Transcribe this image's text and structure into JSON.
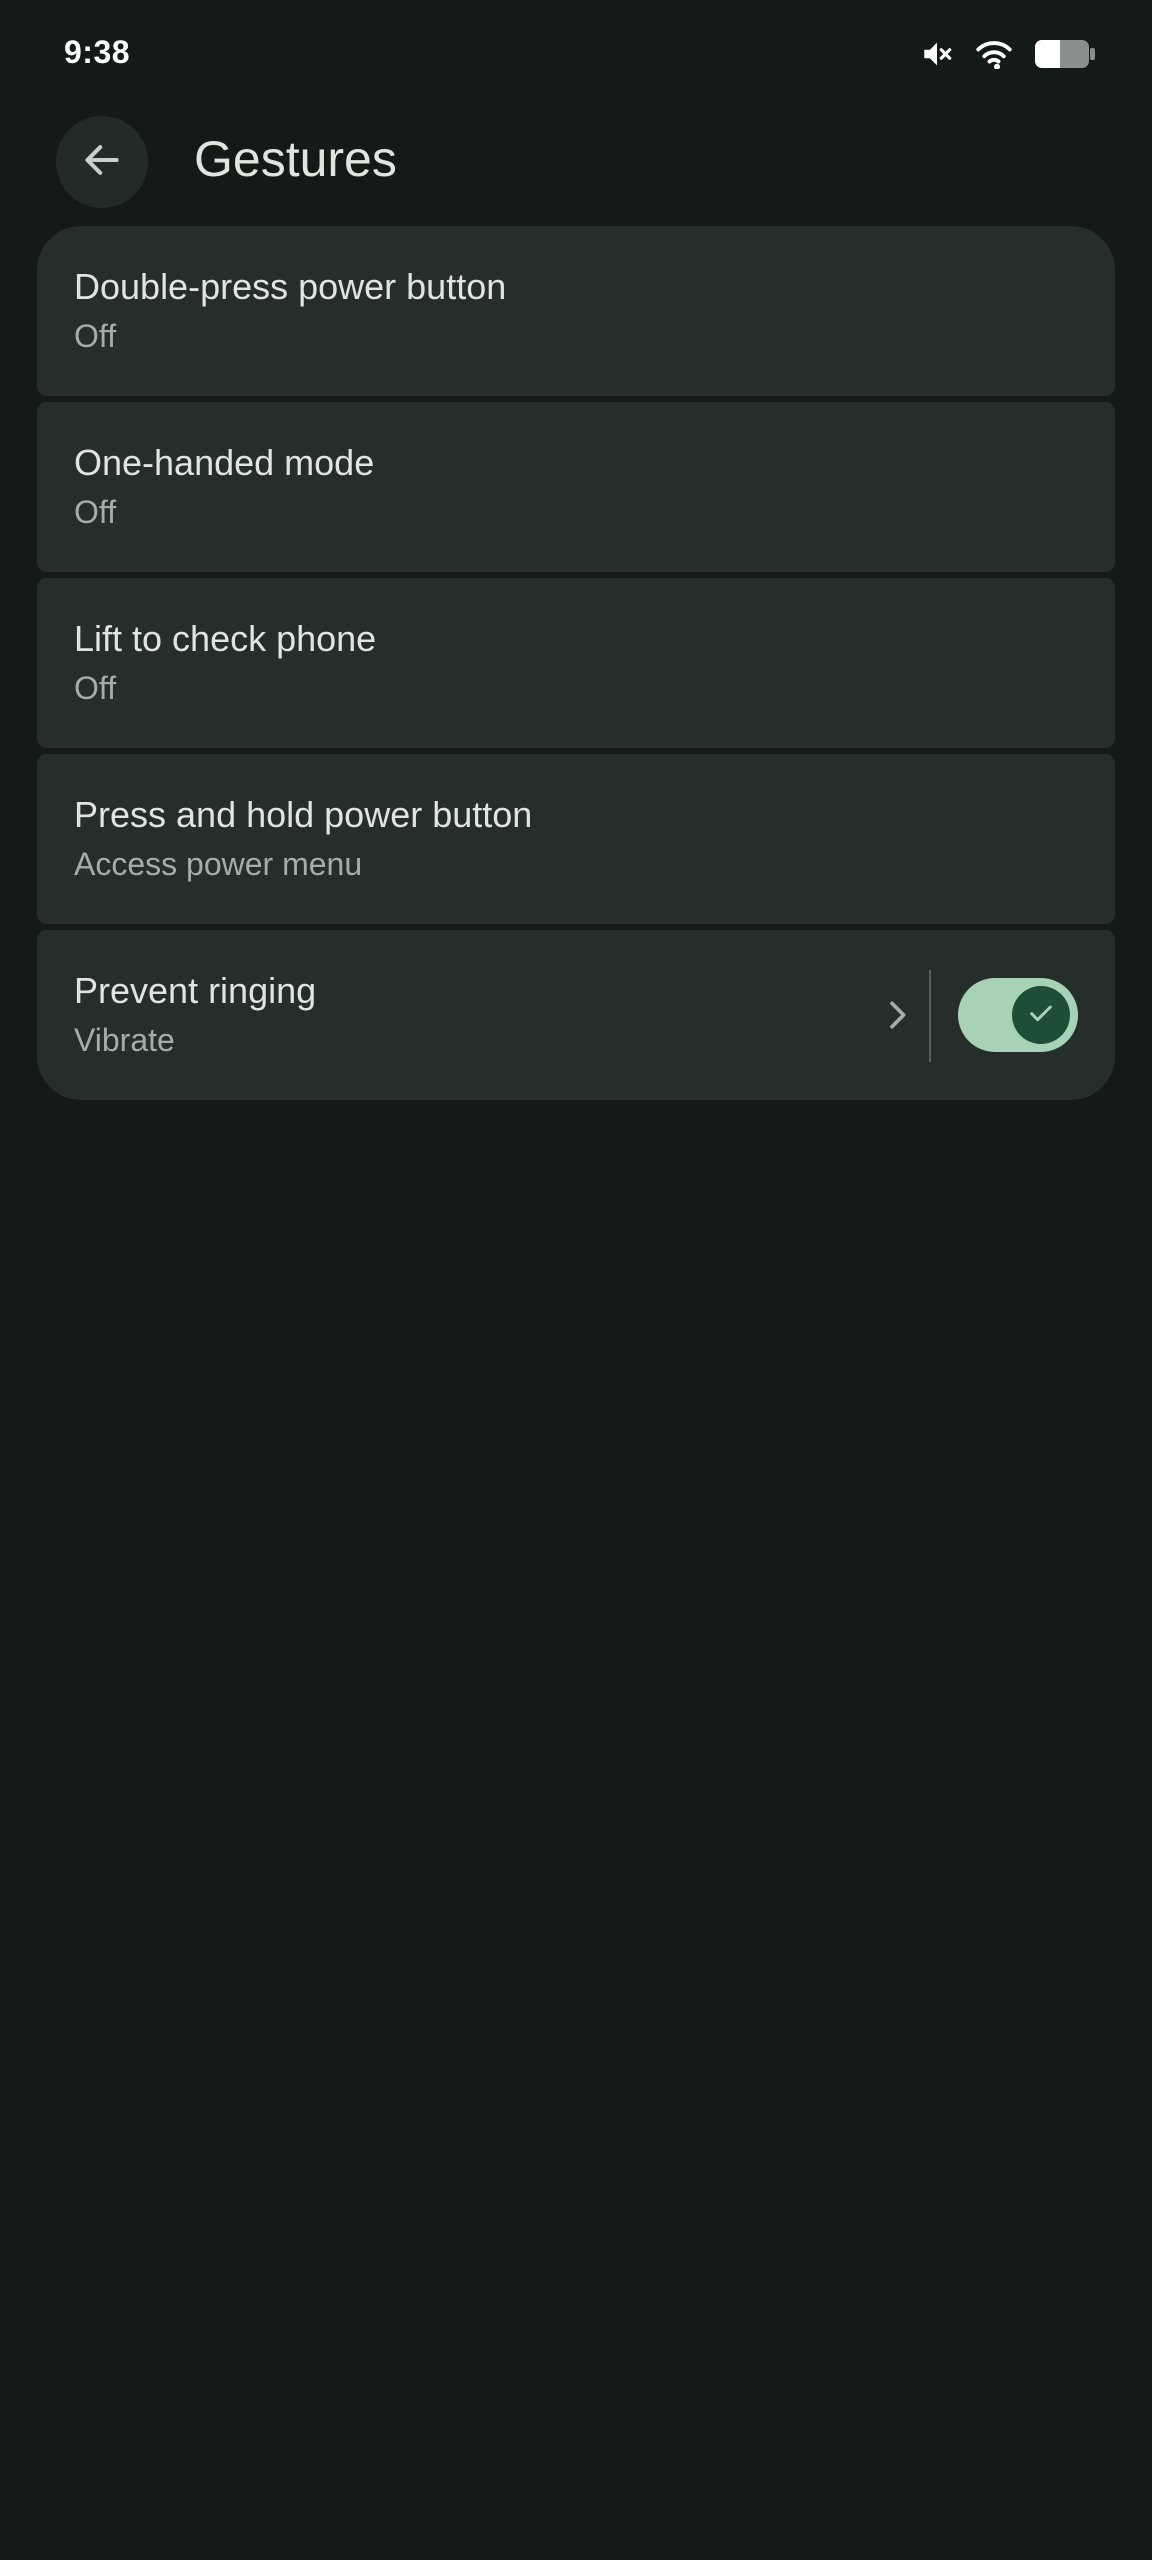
{
  "status_bar": {
    "time": "9:38",
    "icons": [
      "mute-icon",
      "wifi-icon",
      "battery-icon"
    ]
  },
  "header": {
    "title": "Gestures",
    "back_icon": "arrow-back-icon"
  },
  "items": [
    {
      "title": "Double-press power button",
      "subtitle": "Off"
    },
    {
      "title": "One-handed mode",
      "subtitle": "Off"
    },
    {
      "title": "Lift to check phone",
      "subtitle": "Off"
    },
    {
      "title": "Press and hold power button",
      "subtitle": "Access power menu"
    },
    {
      "title": "Prevent ringing",
      "subtitle": "Vibrate",
      "toggle_on": true
    }
  ],
  "colors": {
    "background": "#141a17",
    "card": "#252e2a",
    "toggle_track": "#a7d2b6",
    "toggle_thumb": "#1f4e38"
  }
}
